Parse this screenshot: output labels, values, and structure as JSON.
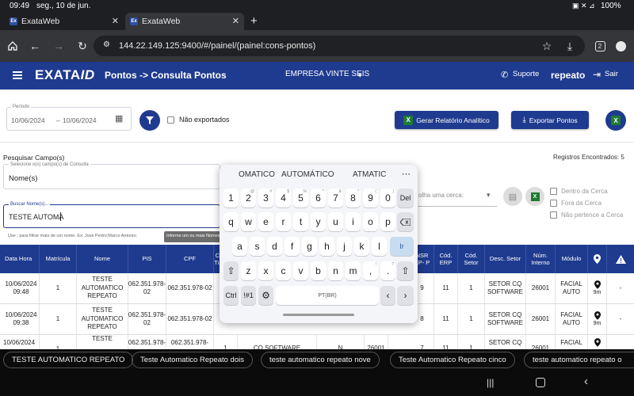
{
  "status": {
    "time": "09:49",
    "date": "seg., 10 de jun.",
    "battery": "100%"
  },
  "tabs": [
    {
      "title": "ExataWeb",
      "favicon": "Ex"
    },
    {
      "title": "ExataWeb",
      "favicon": "Ex"
    }
  ],
  "browser": {
    "url": "144.22.149.125:9400/#/painel/(painel:cons-pontos)",
    "tab_count": "2"
  },
  "header": {
    "logo": "EXATA",
    "logo_suffix": "ID",
    "page_title": "Pontos -> Consulta Pontos",
    "company": "EMPRESA VINTE SEIS",
    "support": "Suporte",
    "user": "repeato",
    "logout": "Sair"
  },
  "filters": {
    "period_label": "Período",
    "period_start": "10/06/2024",
    "period_end": "10/06/2024",
    "not_exported": "Não exportados",
    "search_fields_title": "Pesquisar Campo(s)",
    "search_fields_label": "Selecione o(s) campo(s) de Consulta",
    "search_fields_value": "Nome(s)",
    "search_names_label": "Buscar Nome(s)...",
    "search_names_value": "TESTE AUTOMA",
    "search_hint": "Use ; para filtrar mais de um nome. Ex: Jose Pedro;Marco Antonio;",
    "tooltip": "Informe um ou mais Nomes",
    "fence_placeholder": "olha uma cerca:",
    "fence_options": [
      "Dentro da Cerca",
      "Fora da Cerca",
      "Não pertence a Cerca"
    ]
  },
  "actions": {
    "report": "Gerar Relatório Analítico",
    "export": "Exportar Pontos"
  },
  "records_found": "Registros Encontrados: 5",
  "table": {
    "columns": [
      "Data Hora",
      "Matrícula",
      "Nome",
      "PIS",
      "CPF",
      "C Tu",
      "",
      "",
      "",
      "NSR EP- P",
      "Cód. ERP",
      "Cód. Setor",
      "Desc. Setor",
      "Núm. Interno",
      "Módulo",
      "",
      ""
    ],
    "rows": [
      {
        "data_hora": "10/06/2024 09:48",
        "matricula": "1",
        "nome": "TESTE AUTOMATICO REPEATO",
        "pis": "062.351.978-02",
        "cpf": "062.351.978-02",
        "nsr": "9",
        "cod_erp": "11",
        "cod_setor": "1",
        "desc_setor": "SETOR CQ SOFTWARE",
        "num_interno": "26001",
        "modulo": "FACIAL AUTO",
        "dist": "9m",
        "alert": "-"
      },
      {
        "data_hora": "10/06/2024 09:38",
        "matricula": "1",
        "nome": "TESTE AUTOMATICO REPEATO",
        "pis": "062.351.978-02",
        "cpf": "062.351.978-02",
        "nsr": "8",
        "cod_erp": "11",
        "cod_setor": "1",
        "desc_setor": "SETOR CQ SOFTWARE",
        "num_interno": "26001",
        "modulo": "FACIAL AUTO",
        "dist": "9m",
        "alert": "-"
      },
      {
        "data_hora": "10/06/2024",
        "matricula": "1",
        "nome": "TESTE",
        "pis": "062.351.978-",
        "cpf": "062.351.978-",
        "ctu": "1",
        "col6": "CQ SOFTWARE",
        "col7": "N",
        "col8": "26001",
        "nsr": "7",
        "cod_erp": "11",
        "cod_setor": "1",
        "desc_setor": "SETOR CQ",
        "num_interno": "26001",
        "modulo": "FACIAL",
        "dist": "",
        "alert": ""
      }
    ]
  },
  "keyboard": {
    "suggestions": [
      "OMATICO",
      "AUTOMÁTICO",
      "ATMATIC"
    ],
    "number_row": [
      "1",
      "2",
      "3",
      "4",
      "5",
      "6",
      "7",
      "8",
      "9",
      "0"
    ],
    "number_hints": [
      "",
      "@",
      "#",
      "$",
      "%",
      "^",
      "&",
      "*",
      "(",
      ")"
    ],
    "row1": [
      "q",
      "w",
      "e",
      "r",
      "t",
      "y",
      "u",
      "i",
      "o",
      "p"
    ],
    "row2": [
      "a",
      "s",
      "d",
      "f",
      "g",
      "h",
      "j",
      "k",
      "l"
    ],
    "row3": [
      "z",
      "x",
      "c",
      "v",
      "b",
      "n",
      "m",
      ",",
      "."
    ],
    "row3_hints": [
      "",
      "",
      "",
      "",
      "",
      "",
      "",
      "!",
      "?"
    ],
    "del": "Del",
    "ir": "Ir",
    "ctrl": "Ctrl",
    "sym": "!#1",
    "space": "PT(BR)"
  },
  "chips": [
    "TESTE AUTOMATICO REPEATO",
    "Teste Automatico Repeato dois",
    "teste automatico repeato nove",
    "Teste Automatico Repeato cinco",
    "teste automatico repeato o"
  ],
  "colors": {
    "primary": "#1f3b8f",
    "chrome_dark": "#35363a",
    "excel_green": "#1e7b34"
  }
}
